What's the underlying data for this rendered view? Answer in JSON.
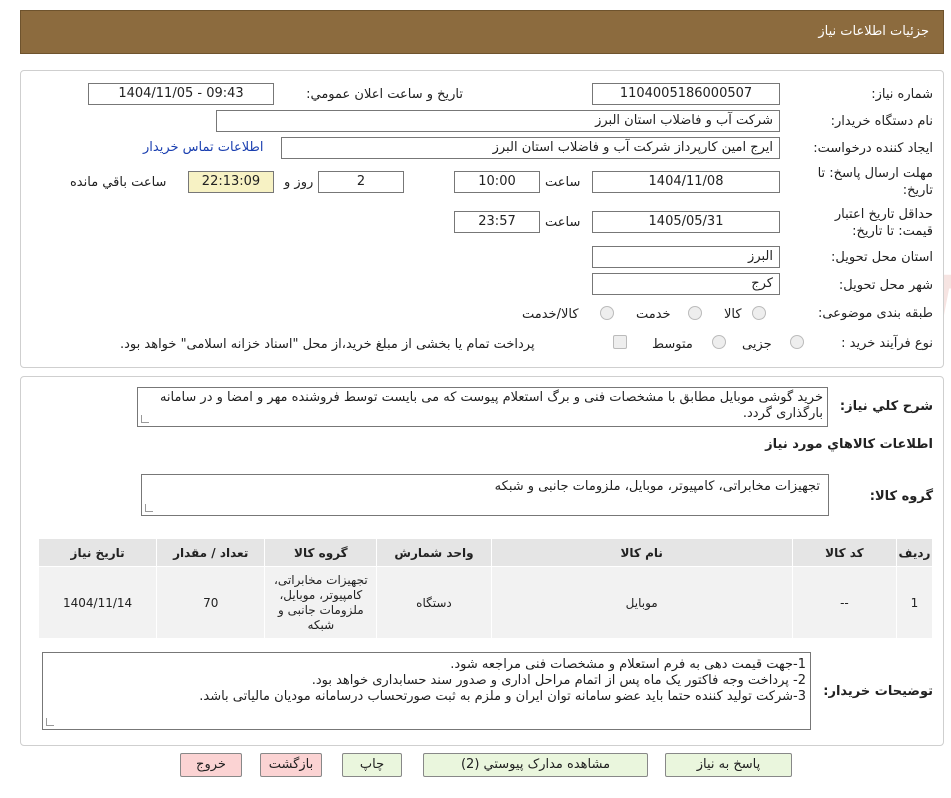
{
  "header": {
    "title": "جزئیات اطلاعات نیاز"
  },
  "fields": {
    "need_number_label": "شماره نیاز:",
    "need_number": "1104005186000507",
    "announce_label": "تاریخ و ساعت اعلان عمومي:",
    "announce_value": "1404/11/05 - 09:43",
    "buyer_org_label": "نام دستگاه خريدار:",
    "buyer_org": "شرکت آب و فاضلاب استان البرز",
    "requester_label": "ایجاد کننده درخواست:",
    "requester": "ایرج امین کارپرداز شرکت آب و فاضلاب استان البرز",
    "contact_link": "اطلاعات تماس خریدار",
    "deadline_label_1": "مهلت ارسال پاسخ: تا",
    "deadline_label_2": "تاریخ:",
    "deadline_date": "1404/11/08",
    "time_label": "ساعت",
    "deadline_time": "10:00",
    "days_value": "2",
    "days_label": "روز و",
    "remaining_time": "22:13:09",
    "remaining_label": "ساعت باقي مانده",
    "validity_label_1": "حداقل تاریخ اعتبار",
    "validity_label_2": "قیمت: تا تاریخ:",
    "validity_date": "1405/05/31",
    "validity_time": "23:57",
    "province_label": "استان محل تحویل:",
    "province": "البرز",
    "city_label": "شهر محل تحویل:",
    "city": "کرج",
    "category_label": "طبقه بندی موضوعی:",
    "category_options": [
      "کالا",
      "خدمت",
      "کالا/خدمت"
    ],
    "process_label": "نوع فرآیند خرید :",
    "process_options": [
      "جزیی",
      "متوسط"
    ],
    "payment_note": "پرداخت تمام یا بخشی از مبلغ خرید،از محل \"اسناد خزانه اسلامی\" خواهد بود."
  },
  "description": {
    "label": "شرح کلي نياز:",
    "text": "خرید گوشی موبایل مطابق با مشخصات فنی و برگ استعلام پیوست که می بایست توسط فروشنده مهر و امضا و در سامانه بارگذاری گردد."
  },
  "goods": {
    "section_title": "اطلاعات کالاهاي مورد نياز",
    "group_label": "گروه کالا:",
    "group_value": "تجهیزات مخابراتی، کامپیوتر، موبایل، ملزومات جانبی و شبکه"
  },
  "table": {
    "headers": [
      "رديف",
      "کد کالا",
      "نام کالا",
      "واحد شمارش",
      "گروه کالا",
      "تعداد / مقدار",
      "تاریخ نیاز"
    ],
    "rows": [
      {
        "row": "1",
        "code": "--",
        "name": "موبایل",
        "unit": "دستگاه",
        "group": "تجهیزات مخابراتی، کامپیوتر، موبایل، ملزومات جانبی و شبکه",
        "qty": "70",
        "date": "1404/11/14"
      }
    ]
  },
  "buyer_notes": {
    "label": "توضیحات خریدار:",
    "lines": [
      "1-جهت قیمت دهی به فرم استعلام و مشخصات فنی مراجعه شود.",
      "2- پرداخت وجه فاکتور یک ماه پس از اتمام مراحل اداری و صدور سند حسابداری خواهد بود.",
      "3-شرکت تولید کننده حتما باید عضو سامانه توان ایران و ملزم به ثبت صورتحساب درسامانه مودیان مالیاتی باشد."
    ]
  },
  "buttons": {
    "reply": "پاسخ به نياز",
    "attachments": "مشاهده مدارک پیوستي (2)",
    "print": "چاپ",
    "back": "بازگشت",
    "exit": "خروج"
  },
  "watermark": {
    "text": "AriaTender.neT"
  },
  "colors": {
    "header_bg": "#8c6b3e",
    "button_green": "#eaf6dd",
    "button_red": "#fbd3d3",
    "link": "#1a3fb0"
  }
}
